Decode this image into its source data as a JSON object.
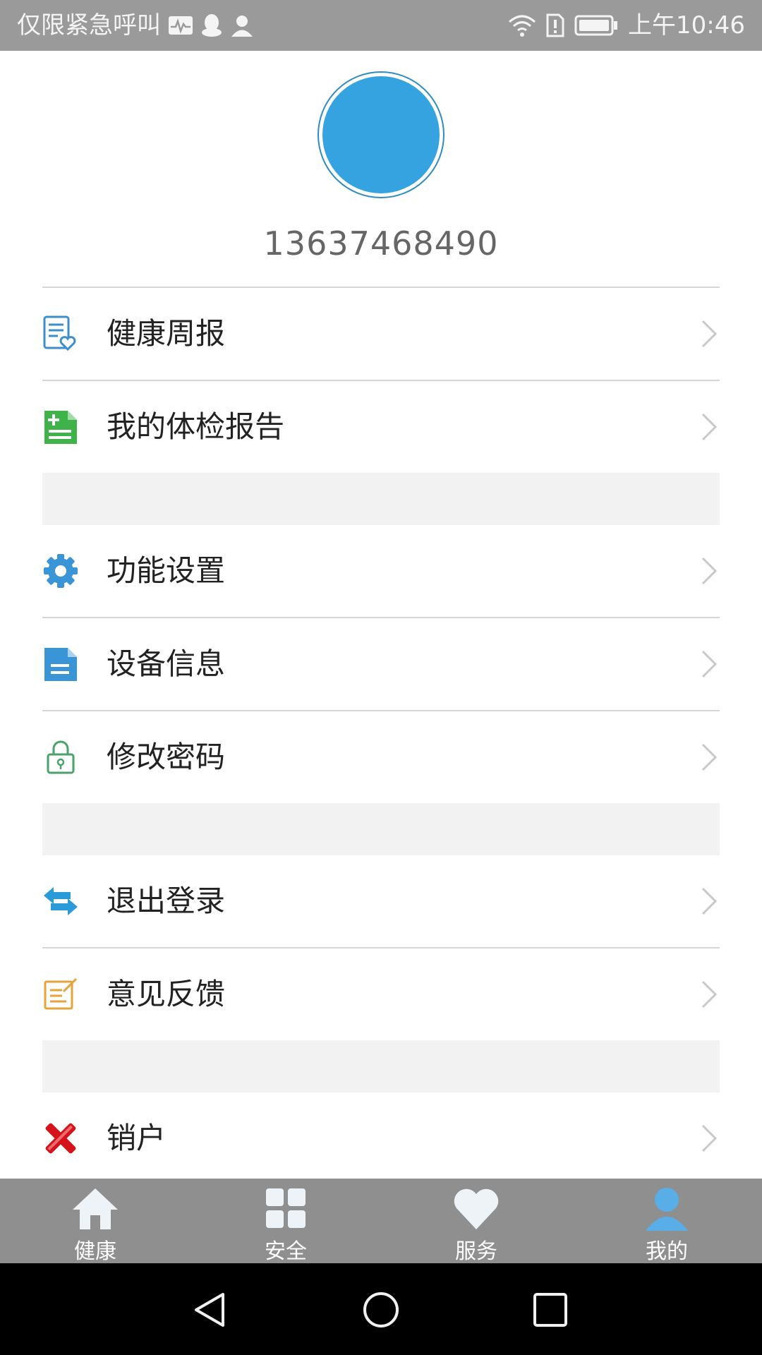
{
  "status_bar": {
    "carrier_text": "仅限紧急呼叫",
    "time": "上午10:46",
    "icons": [
      "activity-icon",
      "qq-icon",
      "contact-icon",
      "wifi-icon",
      "sim-alert-icon",
      "battery-icon"
    ]
  },
  "profile": {
    "phone": "13637468490",
    "avatar_color": "#34a3e0"
  },
  "menu": {
    "items": [
      {
        "label": "健康周报",
        "icon": "health-report-icon"
      },
      {
        "label": "我的体检报告",
        "icon": "checkup-report-icon"
      },
      {
        "label": "功能设置",
        "icon": "gear-icon"
      },
      {
        "label": "设备信息",
        "icon": "document-icon"
      },
      {
        "label": "修改密码",
        "icon": "lock-icon"
      },
      {
        "label": "退出登录",
        "icon": "swap-arrows-icon"
      },
      {
        "label": "意见反馈",
        "icon": "edit-note-icon"
      },
      {
        "label": "销户",
        "icon": "red-x-icon"
      }
    ]
  },
  "bottom_nav": {
    "tabs": [
      {
        "label": "健康",
        "icon": "home-icon",
        "active": false
      },
      {
        "label": "安全",
        "icon": "grid-icon",
        "active": false
      },
      {
        "label": "服务",
        "icon": "heart-icon",
        "active": false
      },
      {
        "label": "我的",
        "icon": "user-icon",
        "active": true
      }
    ],
    "active_color": "#5aaee8"
  },
  "system_nav": {
    "buttons": [
      "back-icon",
      "home-circle-icon",
      "recents-icon"
    ]
  }
}
